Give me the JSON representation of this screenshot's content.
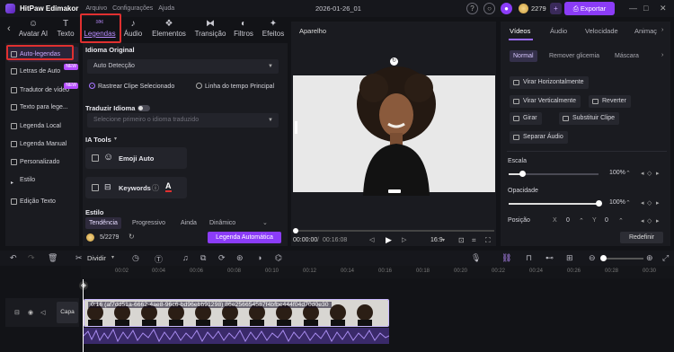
{
  "titlebar": {
    "app_name": "HitPaw Edimakor",
    "menus": [
      "Arquivo",
      "Configurações",
      "Ajuda"
    ],
    "doc_title": "2026-01-26_01",
    "credits": "2279",
    "export_label": "Exportar"
  },
  "tool_tabs": [
    "Avatar AI",
    "Texto",
    "Legendas",
    "Áudio",
    "Elementos",
    "Transição",
    "Filtros",
    "Efeitos"
  ],
  "sidebar": {
    "items": [
      {
        "label": "Auto-legendas",
        "badge": ""
      },
      {
        "label": "Letras de Auto",
        "badge": "NEW"
      },
      {
        "label": "Tradutor de vídeo",
        "badge": "NEW"
      },
      {
        "label": "Texto para lege...",
        "badge": ""
      },
      {
        "label": "Legenda Local",
        "badge": ""
      },
      {
        "label": "Legenda Manual",
        "badge": ""
      },
      {
        "label": "Personalizado",
        "badge": ""
      },
      {
        "label": "Estilo",
        "badge": ""
      },
      {
        "label": "Edição Texto",
        "badge": ""
      }
    ]
  },
  "captions": {
    "original_language_title": "Idioma Original",
    "language_value": "Auto Detecção",
    "radio_selected_clip": "Rastrear Clipe Selecionado",
    "radio_timeline": "Linha do tempo Principal",
    "translate_title": "Traduzir Idioma",
    "translate_placeholder": "Selecione primeiro o idioma traduzido",
    "ai_tools_title": "IA Tools",
    "tool_emoji": "Emoji Auto",
    "tool_keywords": "Keywords",
    "style_title": "Estilo",
    "style_tabs": [
      "Tendência",
      "Progressivo",
      "Ainda",
      "Dinâmico"
    ],
    "credits": "5/2279",
    "auto_button": "Legenda Automática"
  },
  "preview": {
    "title": "Aparelho",
    "time_current": "00:00:00",
    "time_total": "00:16:08",
    "ratio": "16:9"
  },
  "right_panel": {
    "tabs": [
      "Vídeos",
      "Áudio",
      "Velocidade",
      "Animaç"
    ],
    "sub_tabs": [
      "Normal",
      "Remover glicemia",
      "Máscara"
    ],
    "buttons": [
      "Virar Horizontalmente",
      "Virar Verticalmente",
      "Reverter",
      "Girar",
      "Substituir Clipe",
      "Separar Áudio"
    ],
    "scale_label": "Escala",
    "scale_value": "100%",
    "scale_level": 0.15,
    "opacity_label": "Opacidade",
    "opacity_value": "100%",
    "opacity_level": 1.0,
    "position_label": "Posição",
    "pos_x_label": "X",
    "pos_x": "0",
    "pos_y_label": "Y",
    "pos_y": "0",
    "reset_label": "Redefinir"
  },
  "timeline": {
    "split_label": "Dividir",
    "ticks": [
      "00:02",
      "00:04",
      "00:06",
      "00:08",
      "00:10",
      "00:12",
      "00:14",
      "00:16",
      "00:18",
      "00:20",
      "00:22",
      "00:24",
      "00:26",
      "00:28",
      "00:30",
      "00:32"
    ],
    "track_label": "Capa",
    "clip_label": "0:16 (af7dd51a-6662-4ae8-96c6-bd96ebb91298) 86e256654587f4bfbe444f04d70d0e30"
  },
  "colors": {
    "accent": "#8b3cf7",
    "highlight_box": "#e03030",
    "active_text": "#b98cff"
  }
}
